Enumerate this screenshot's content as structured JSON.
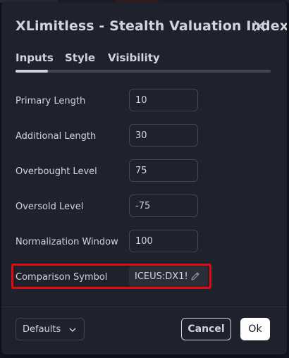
{
  "dialog": {
    "title": "XLimitless - Stealth Valuation Index",
    "close_icon": "close-icon"
  },
  "tabs": [
    {
      "label": "Inputs",
      "active": true
    },
    {
      "label": "Style",
      "active": false
    },
    {
      "label": "Visibility",
      "active": false
    }
  ],
  "inputs": [
    {
      "label": "Primary Length",
      "value": "10"
    },
    {
      "label": "Additional Length",
      "value": "30"
    },
    {
      "label": "Overbought Level",
      "value": "75"
    },
    {
      "label": "Oversold Level",
      "value": "-75"
    },
    {
      "label": "Normalization Window",
      "value": "100"
    }
  ],
  "symbol": {
    "label": "Comparison Symbol",
    "value": "ICEUS:DX1!",
    "edit_icon": "pencil-icon"
  },
  "footer": {
    "defaults_label": "Defaults",
    "cancel_label": "Cancel",
    "ok_label": "Ok"
  },
  "colors": {
    "background": "#1e222d",
    "text": "#d1d4dc",
    "border": "#434651",
    "highlight": "#e50914"
  }
}
